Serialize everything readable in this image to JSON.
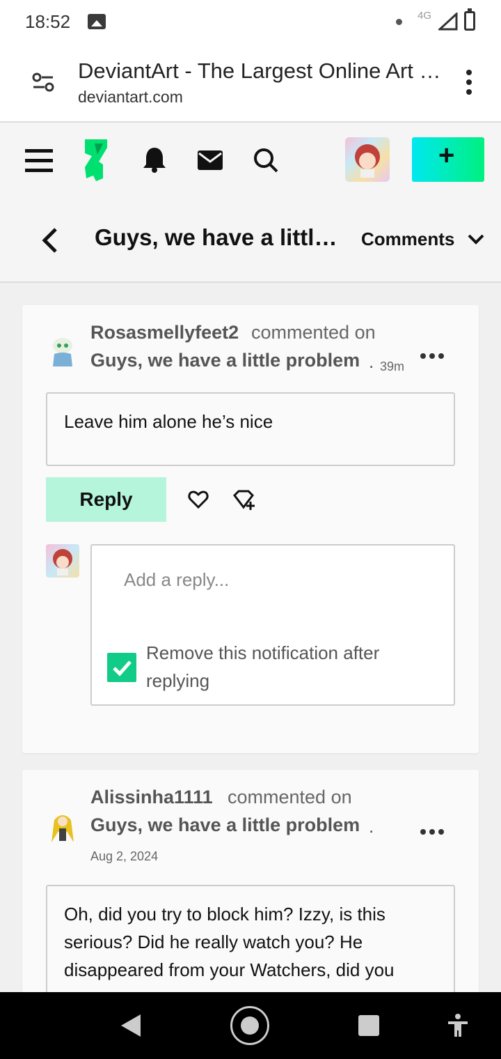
{
  "status_bar": {
    "time": "18:52",
    "network": "4G",
    "icons": [
      "image-icon",
      "dot-icon",
      "signal-icon",
      "battery-icon"
    ]
  },
  "browser": {
    "page_title": "DeviantArt - The Largest Online Art …",
    "domain": "deviantart.com",
    "icons": [
      "tune-icon",
      "more-vert-icon"
    ]
  },
  "site_header": {
    "icons": [
      "hamburger-icon",
      "deviantart-logo-icon",
      "bell-icon",
      "mail-icon",
      "search-icon",
      "user-avatar",
      "plus-icon"
    ],
    "create_label": "+"
  },
  "page_bar": {
    "title": "Guys, we have a littl…",
    "dropdown_label": "Comments"
  },
  "comments": [
    {
      "username": "Rosasmellyfeet2",
      "verb": "commented on",
      "deviation": "Guys, we have a little problem",
      "separator": ".",
      "time": "39m",
      "text": "Leave him alone he’s nice",
      "reply_label": "Reply",
      "reply_placeholder": "Add a reply...",
      "remove_notification_label": "Remove this notification after replying",
      "remove_notification_checked": true
    },
    {
      "username": "Alissinha1111",
      "verb": "commented on",
      "deviation": "Guys, we have a little problem",
      "separator": ".",
      "time": "Aug 2, 2024",
      "text": "Oh, did you try to block him? Izzy, is this serious? Did he really watch you? He disappeared from your Watchers, did you"
    }
  ],
  "colors": {
    "accent_green": "#00f080",
    "accent_cyan": "#00e8f0",
    "reply_button_bg": "#b4f5dc",
    "checkbox_green": "#11cc88"
  }
}
